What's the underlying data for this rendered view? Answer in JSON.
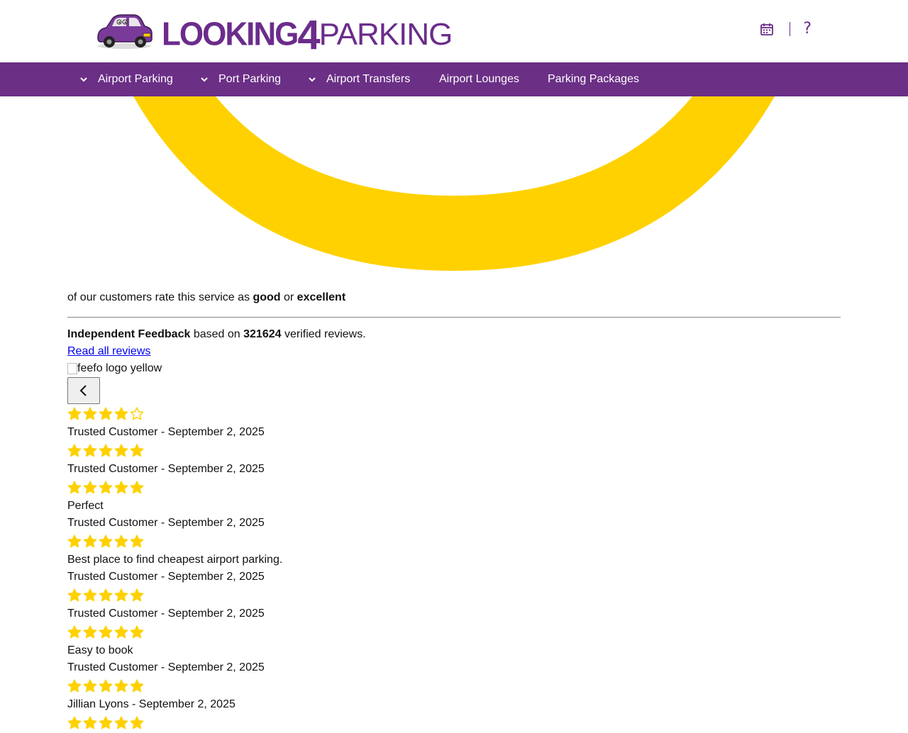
{
  "header": {
    "logo_text_looking": "LOOKING",
    "logo_text_four": "4",
    "logo_text_parking": "PARKING",
    "calendar_icon": "calendar-icon",
    "help_label": "?"
  },
  "nav": {
    "items": [
      {
        "label": "Airport Parking",
        "has_dropdown": true
      },
      {
        "label": "Port Parking",
        "has_dropdown": true
      },
      {
        "label": "Airport Transfers",
        "has_dropdown": true
      },
      {
        "label": "Airport Lounges",
        "has_dropdown": false
      },
      {
        "label": "Parking Packages",
        "has_dropdown": false
      }
    ]
  },
  "rating": {
    "prefix": "of our customers rate this service as",
    "good": "good",
    "or": "or",
    "excellent": "excellent"
  },
  "feedback": {
    "title": "Independent Feedback",
    "based_on": "based on",
    "count": "321624",
    "suffix": "verified reviews.",
    "read_all": "Read all reviews",
    "feefo_alt": "feefo logo yellow"
  },
  "colors": {
    "brand_purple": "#6b2f86",
    "star_yellow": "#ffd100",
    "link_blue": "#0000ee"
  },
  "reviews": [
    {
      "stars": 4,
      "title": "",
      "author_line": "Trusted Customer - September 2, 2025"
    },
    {
      "stars": 5,
      "title": "",
      "author_line": "Trusted Customer - September 2, 2025"
    },
    {
      "stars": 5,
      "title": "Perfect",
      "author_line": "Trusted Customer - September 2, 2025"
    },
    {
      "stars": 5,
      "title": "Best place to find cheapest airport parking.",
      "author_line": "Trusted Customer - September 2, 2025"
    },
    {
      "stars": 5,
      "title": "",
      "author_line": "Trusted Customer - September 2, 2025"
    },
    {
      "stars": 5,
      "title": "Easy to book",
      "author_line": "Trusted Customer - September 2, 2025"
    },
    {
      "stars": 5,
      "title": "",
      "author_line": "Jillian Lyons - September 2, 2025"
    },
    {
      "stars": 5,
      "title": "",
      "author_line": ""
    }
  ]
}
